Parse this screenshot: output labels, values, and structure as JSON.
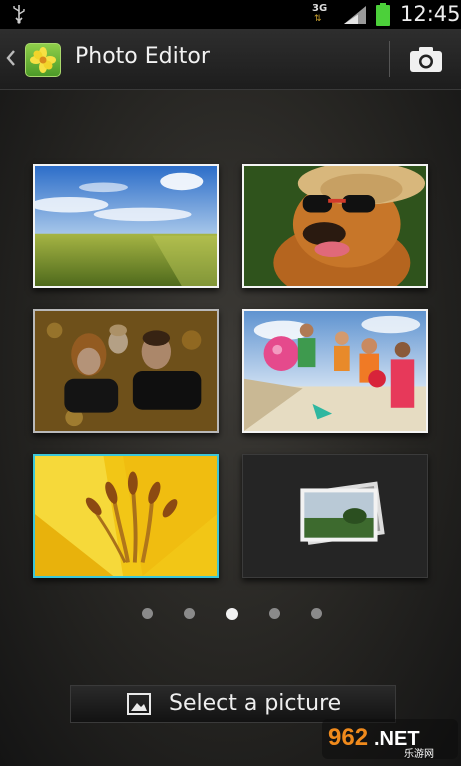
{
  "status_bar": {
    "network_type": "3G",
    "time": "12:45",
    "icons": [
      "usb-icon",
      "data-arrows-icon",
      "signal-icon",
      "battery-icon"
    ]
  },
  "action_bar": {
    "title": "Photo Editor",
    "icons": [
      "back-chevron-icon",
      "photo-editor-app-icon",
      "camera-icon"
    ]
  },
  "gallery": {
    "thumbnails": [
      {
        "name": "landscape-field-sky"
      },
      {
        "name": "dog-sunglasses-hat"
      },
      {
        "name": "family-in-leaves"
      },
      {
        "name": "kids-on-beach"
      },
      {
        "name": "yellow-lily",
        "selected": true
      },
      {
        "name": "empty-placeholder",
        "icon": "photo-stack-icon"
      }
    ],
    "page_indicator": {
      "count": 5,
      "active_index": 2
    }
  },
  "select_button": {
    "label": "Select a picture",
    "icon": "picture-icon"
  },
  "watermark": {
    "text": "962.NET",
    "subtext": "乐游网"
  },
  "colors": {
    "selection_border": "#3cc6d8",
    "battery": "#4cd03a",
    "background": "#141414"
  }
}
